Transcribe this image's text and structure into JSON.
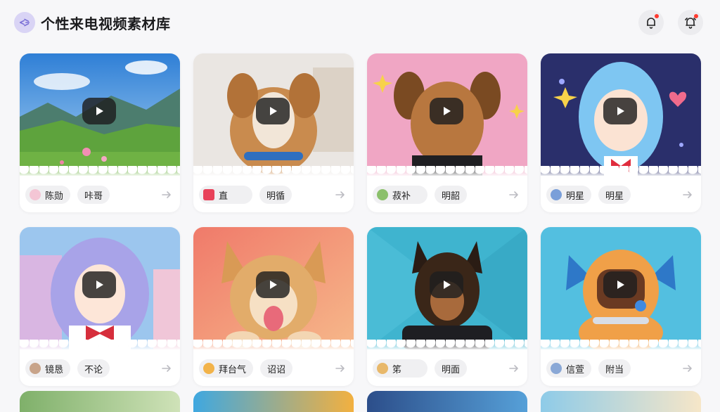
{
  "app": {
    "title": "个性来电视频素材库"
  },
  "header": {
    "notification_icon": "bell-badge-icon",
    "alarm_icon": "bell-ring-icon",
    "badge_color": "#ff3b30"
  },
  "cards": [
    {
      "tag1": "陈勋",
      "tag2": "咔哥",
      "scene": "landscape"
    },
    {
      "tag1": "直",
      "tag2": "明循",
      "scene": "dog-small"
    },
    {
      "tag1": "菽补",
      "tag2": "明韶",
      "scene": "dog-man"
    },
    {
      "tag1": "明星",
      "tag2": "明星",
      "scene": "anime-girl-blue"
    },
    {
      "tag1": "镜恳",
      "tag2": "不论",
      "scene": "anime-girl-purple"
    },
    {
      "tag1": "拜台气",
      "tag2": "诏诏",
      "scene": "dog-corgi"
    },
    {
      "tag1": "笫",
      "tag2": "明面",
      "scene": "dog-punk"
    },
    {
      "tag1": "信萱",
      "tag2": "附当",
      "scene": "robot"
    }
  ],
  "colors": {
    "accent": "#8a7fe0",
    "card_bg": "#ffffff",
    "tag_bg": "#f0f0f2"
  }
}
